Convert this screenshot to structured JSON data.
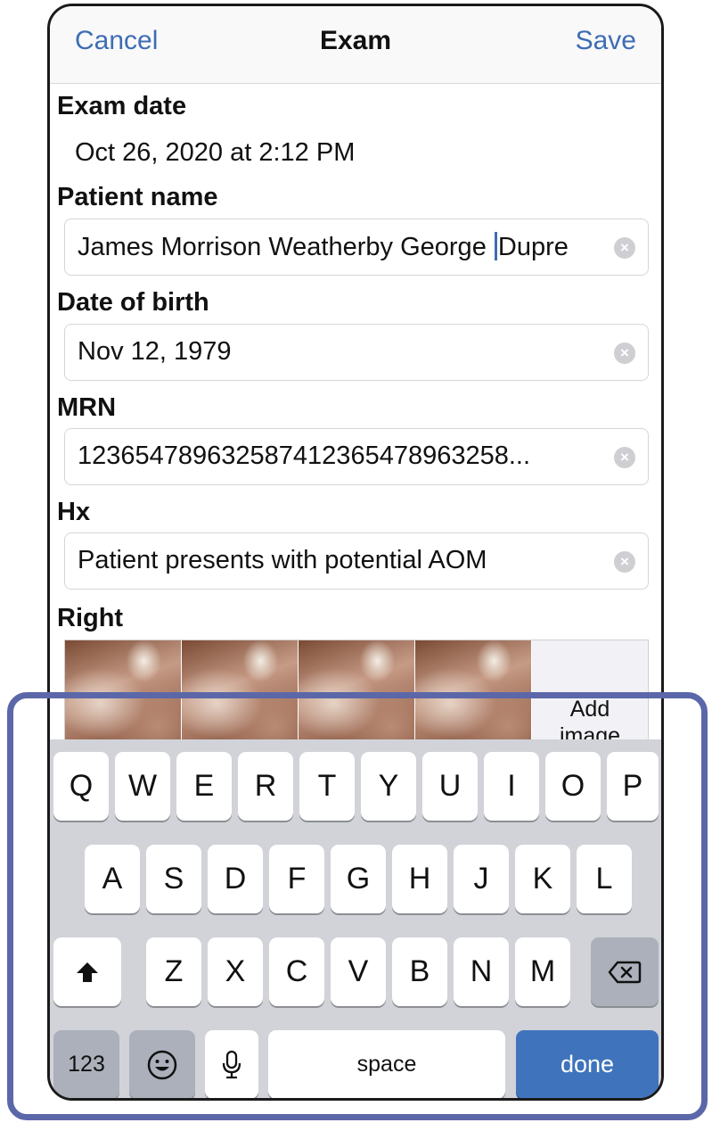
{
  "nav": {
    "cancel": "Cancel",
    "title": "Exam",
    "save": "Save"
  },
  "form": {
    "exam_date_label": "Exam date",
    "exam_date_value": "Oct 26, 2020 at 2:12 PM",
    "patient_name_label": "Patient name",
    "patient_name_value_before": "James Morrison Weatherby George ",
    "patient_name_value_after": "Dupre",
    "dob_label": "Date of birth",
    "dob_value": "Nov 12, 1979",
    "mrn_label": "MRN",
    "mrn_value": "123654789632587412365478963258...",
    "hx_label": "Hx",
    "hx_value": "Patient presents with potential AOM",
    "right_label": "Right",
    "add_image_line1": "Add",
    "add_image_line2": "image"
  },
  "keyboard": {
    "row1": [
      "Q",
      "W",
      "E",
      "R",
      "T",
      "Y",
      "U",
      "I",
      "O",
      "P"
    ],
    "row2": [
      "A",
      "S",
      "D",
      "F",
      "G",
      "H",
      "J",
      "K",
      "L"
    ],
    "row3": [
      "Z",
      "X",
      "C",
      "V",
      "B",
      "N",
      "M"
    ],
    "numbers": "123",
    "space": "space",
    "done": "done"
  },
  "colors": {
    "accent": "#3d6db3",
    "done_key": "#3f74bd",
    "highlight_outline": "#5b67a8"
  }
}
